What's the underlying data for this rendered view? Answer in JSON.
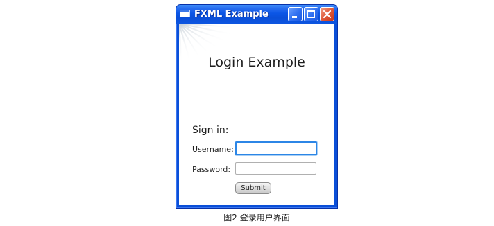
{
  "window": {
    "title": "FXML Example",
    "accent": "#0a4fd8",
    "close_color": "#e05a3a"
  },
  "login": {
    "heading": "Login Example",
    "sign_in_label": "Sign in:",
    "username_label": "Username:",
    "username_value": "",
    "password_label": "Password:",
    "password_value": "",
    "submit_label": "Submit"
  },
  "caption": "图2 登录用户界面"
}
